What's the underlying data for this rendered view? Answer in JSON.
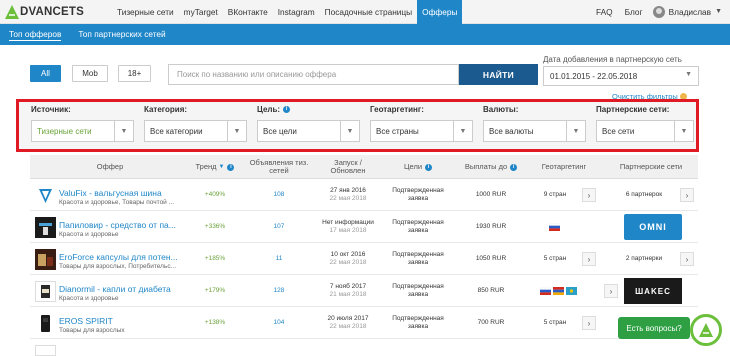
{
  "brand": {
    "logo_text": "DVANCETS",
    "accent": "#1f86c8",
    "highlight": "#e01a24"
  },
  "topnav": {
    "items": [
      {
        "label": "Тизерные сети",
        "active": false
      },
      {
        "label": "myTarget",
        "active": false
      },
      {
        "label": "ВКонтакте",
        "active": false
      },
      {
        "label": "Instagram",
        "active": false
      },
      {
        "label": "Посадочные страницы",
        "active": false
      },
      {
        "label": "Офферы",
        "active": true
      }
    ],
    "faq": "FAQ",
    "blog": "Блог",
    "user": "Владислав"
  },
  "subnav": {
    "tabs": [
      {
        "label": "Топ офферов",
        "active": true
      },
      {
        "label": "Топ партнерских сетей",
        "active": false
      }
    ]
  },
  "search": {
    "filters": [
      "All",
      "Mob",
      "18+"
    ],
    "placeholder": "Поиск по названию или описанию оффера",
    "button": "НАЙТИ",
    "date_label": "Дата добавления в партнерскую сеть",
    "date_value": "01.01.2015 - 22.05.2018",
    "clear": "Очистить фильтры"
  },
  "filters": [
    {
      "label": "Источник:",
      "value": "Тизерные сети"
    },
    {
      "label": "Категория:",
      "value": "Все категории"
    },
    {
      "label": "Цель:",
      "value": "Все цели"
    },
    {
      "label": "Геотаргетинг:",
      "value": "Все страны"
    },
    {
      "label": "Валюты:",
      "value": "Все валюты"
    },
    {
      "label": "Партнерские сети:",
      "value": "Все сети"
    }
  ],
  "table": {
    "headers": {
      "offer": "Оффер",
      "trend": "Тренд",
      "ads": "Объявления тиз. сетей",
      "launch": "Запуск / Обновлен",
      "goals": "Цели",
      "payouts": "Выплаты до",
      "geo": "Геотаргетинг",
      "partners": "Партнерские сети"
    },
    "rows": [
      {
        "name": "ValuFix - вальгусная шина",
        "category": "Красота и здоровье, Товары почтой ...",
        "trend": "+409%",
        "ads": "108",
        "launch": "27 янв 2016",
        "updated": "22 мая 2018",
        "goal": "Подтвержденная заявка",
        "payout": "1000 RUR",
        "geo": "9 стран",
        "partners": "6 партнерок",
        "partner_logo": ""
      },
      {
        "name": "Папиловир - средство от па...",
        "category": "Красота и здоровье",
        "trend": "+336%",
        "ads": "107",
        "launch": "Нет информации",
        "updated": "17 мая 2018",
        "goal": "Подтвержденная заявка",
        "payout": "1930 RUR",
        "geo": "",
        "partners": "",
        "partner_logo": "OMNI"
      },
      {
        "name": "EroForce капсулы для потен...",
        "category": "Товары для взрослых, Потребительс...",
        "trend": "+185%",
        "ads": "11",
        "launch": "10 окт 2016",
        "updated": "22 мая 2018",
        "goal": "Подтвержденная заявка",
        "payout": "1050 RUR",
        "geo": "5 стран",
        "partners": "2 партнерки",
        "partner_logo": ""
      },
      {
        "name": "Dianormil - капли от диабета",
        "category": "Красота и здоровье",
        "trend": "+179%",
        "ads": "128",
        "launch": "7 нояб 2017",
        "updated": "21 мая 2018",
        "goal": "Подтвержденная заявка",
        "payout": "850 RUR",
        "geo": "",
        "partners": "",
        "partner_logo": "ШAKEC"
      },
      {
        "name": "EROS SPIRIT",
        "category": "Товары для взрослых",
        "trend": "+138%",
        "ads": "104",
        "launch": "20 июля 2017",
        "updated": "22 мая 2018",
        "goal": "Подтвержденная заявка",
        "payout": "700 RUR",
        "geo": "5 стран",
        "partners": "",
        "partner_logo": ""
      }
    ]
  },
  "chat": {
    "label": "Есть вопросы?"
  }
}
